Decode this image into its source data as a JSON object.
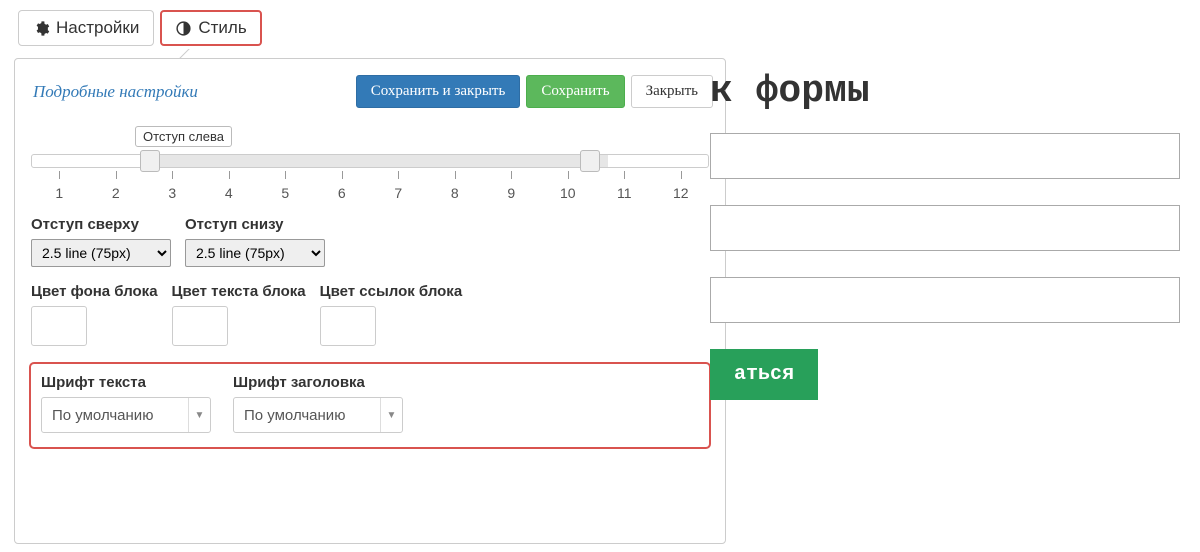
{
  "tabs": {
    "settings": "Настройки",
    "style": "Стиль"
  },
  "panel": {
    "detailed_link": "Подробные настройки",
    "save_close": "Сохранить и закрыть",
    "save": "Сохранить",
    "close": "Закрыть"
  },
  "slider": {
    "tooltip": "Отступ слева",
    "ticks": [
      "1",
      "2",
      "3",
      "4",
      "5",
      "6",
      "7",
      "8",
      "9",
      "10",
      "11",
      "12"
    ]
  },
  "margins": {
    "top_label": "Отступ сверху",
    "top_value": "2.5 line (75px)",
    "bottom_label": "Отступ снизу",
    "bottom_value": "2.5 line (75px)"
  },
  "colors": {
    "bg_label": "Цвет фона блока",
    "text_label": "Цвет текста блока",
    "link_label": "Цвет ссылок блока"
  },
  "fonts": {
    "text_label": "Шрифт текста",
    "text_value": "По умолчанию",
    "heading_label": "Шрифт заголовка",
    "heading_value": "По умолчанию"
  },
  "preview": {
    "title_fragment": "к формы",
    "submit": "аться"
  }
}
